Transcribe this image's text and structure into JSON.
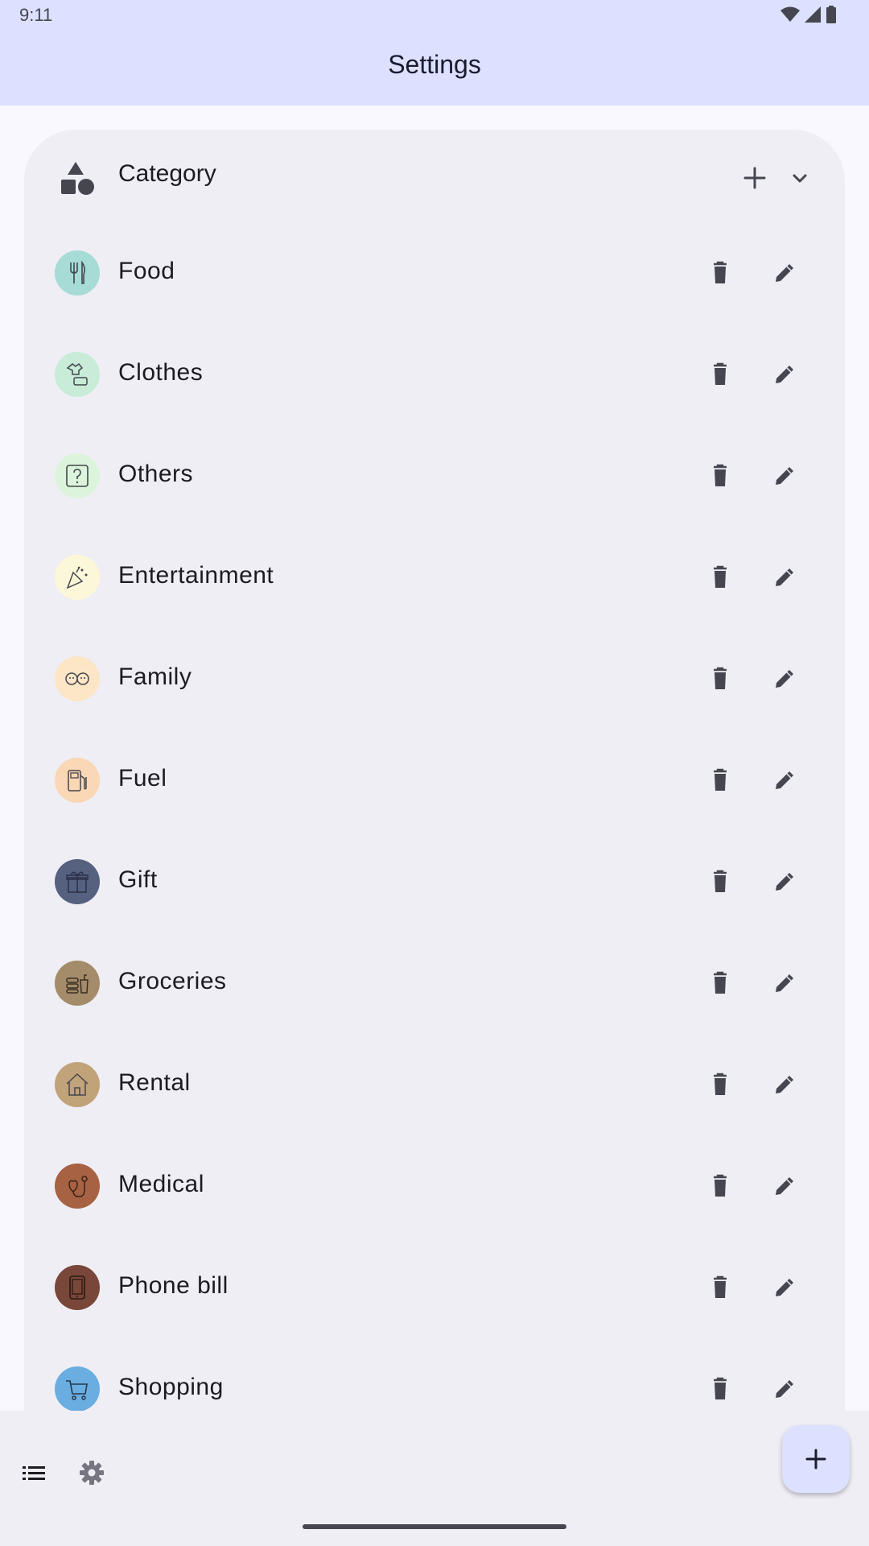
{
  "status_bar": {
    "time": "9:11"
  },
  "app_bar": {
    "title": "Settings"
  },
  "section": {
    "label": "Category",
    "icon": "category-shapes-icon"
  },
  "categories": [
    {
      "label": "Food",
      "icon": "fork-knife-icon",
      "color": "#a6dbd6"
    },
    {
      "label": "Clothes",
      "icon": "clothes-icon",
      "color": "#c8ecd7"
    },
    {
      "label": "Others",
      "icon": "question-icon",
      "color": "#dcf4dc"
    },
    {
      "label": "Entertainment",
      "icon": "party-popper-icon",
      "color": "#fcf7d9"
    },
    {
      "label": "Family",
      "icon": "family-icon",
      "color": "#fde6c6"
    },
    {
      "label": "Fuel",
      "icon": "fuel-pump-icon",
      "color": "#fad7b5"
    },
    {
      "label": "Gift",
      "icon": "gift-icon",
      "color": "#566180"
    },
    {
      "label": "Groceries",
      "icon": "groceries-icon",
      "color": "#a48c6b"
    },
    {
      "label": "Rental",
      "icon": "house-icon",
      "color": "#c1a379"
    },
    {
      "label": "Medical",
      "icon": "stethoscope-icon",
      "color": "#a66242"
    },
    {
      "label": "Phone bill",
      "icon": "phone-icon",
      "color": "#79473a"
    },
    {
      "label": "Shopping",
      "icon": "cart-icon",
      "color": "#6aaee1"
    }
  ],
  "colors": {
    "app_bar": "#dce1ff",
    "card": "#efeef5",
    "icon_dark": "#45464f",
    "fab": "#dce1ff"
  }
}
